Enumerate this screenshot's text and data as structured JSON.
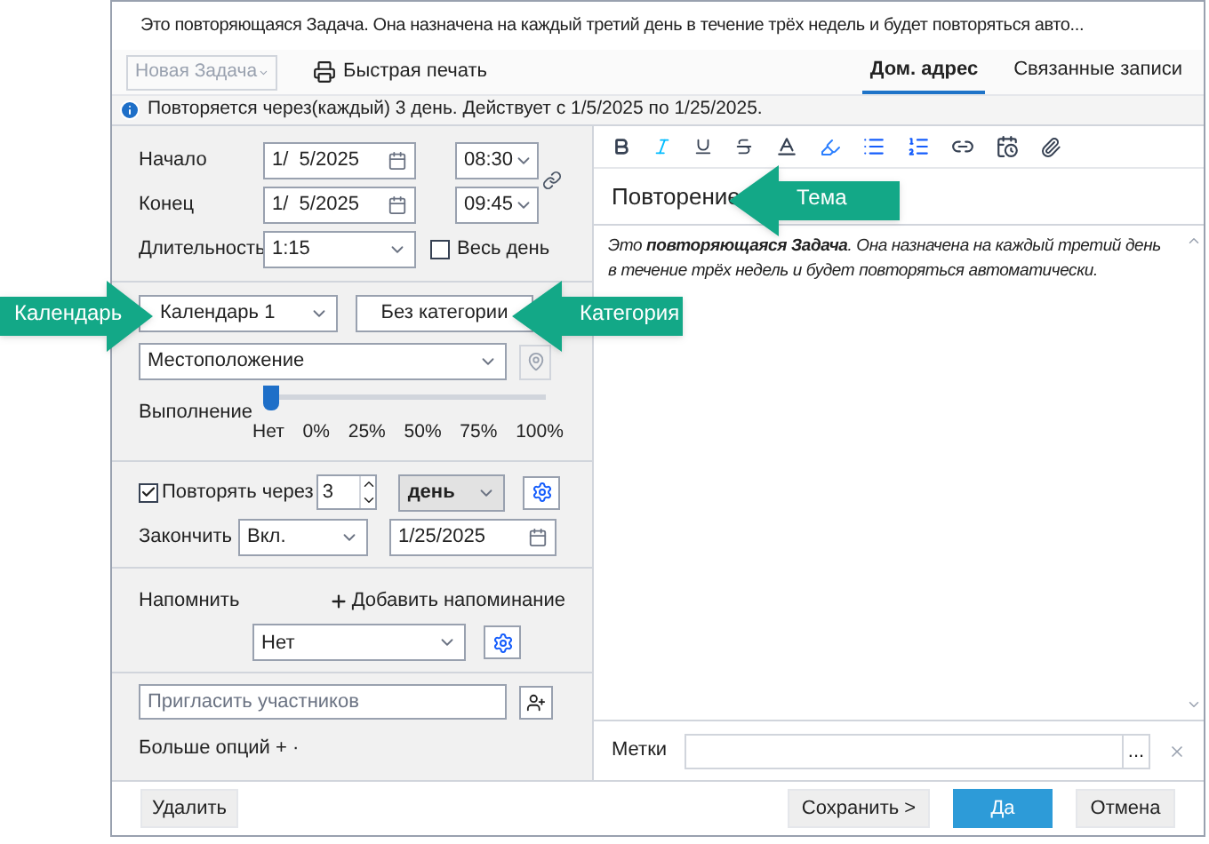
{
  "window": {
    "title": "Это повторяющаяся Задача. Она назначена на каждый третий день в течение трёх недель и будет повторяться авто..."
  },
  "toolbar": {
    "item_type": {
      "value": "Новая Задача",
      "disabled": true
    },
    "print": "Быстрая печать",
    "tabs": [
      {
        "label": "Дом. адрес",
        "selected": true
      },
      {
        "label": "Связанные записи",
        "selected": false
      }
    ]
  },
  "info": "Повторяется через(каждый) 3 день. Действует с 1/5/2025 по 1/25/2025.",
  "form": {
    "start": {
      "label": "Начало",
      "date": "1/  5/2025",
      "time": "08:30"
    },
    "end": {
      "label": "Конец",
      "date": "1/  5/2025",
      "time": "09:45"
    },
    "duration": {
      "label": "Длительность",
      "value": "1:15"
    },
    "all_day": {
      "label": "Весь день",
      "checked": false
    },
    "calendar": "Календарь 1",
    "category": "Без категории",
    "location": {
      "placeholder": "Местоположение"
    },
    "progress": {
      "label": "Выполнение",
      "level": 0,
      "ticks": [
        "Нет",
        "0%",
        "25%",
        "50%",
        "75%",
        "100%"
      ]
    },
    "repeat": {
      "label": "Повторять через",
      "checked": true,
      "count": "3",
      "unit": "день"
    },
    "finish": {
      "label": "Закончить",
      "mode": "Вкл.",
      "date": "1/25/2025"
    },
    "remind": {
      "label": "Напомнить",
      "add": "Добавить напоминание",
      "value": "Нет"
    },
    "invite": {
      "placeholder": "Пригласить участников"
    },
    "more": "Больше опций + ·"
  },
  "editor": {
    "subject": "Повторение",
    "body": "Это **повторяющаяся Задача**. Она назначена на каждый третий день в течение трёх недель и будет повторяться автоматически."
  },
  "tags": {
    "label": "Метки",
    "more": "..."
  },
  "footer": {
    "delete": "Удалить",
    "buttons": [
      {
        "label": "Сохранить >",
        "kind": "normal"
      },
      {
        "label": "Да",
        "kind": "primary"
      },
      {
        "label": "Отмена",
        "kind": "normal"
      }
    ]
  },
  "callouts": [
    {
      "label": "Календарь",
      "kind": "right"
    },
    {
      "label": "Категория",
      "kind": "left"
    },
    {
      "label": "Тема",
      "kind": "left"
    }
  ]
}
